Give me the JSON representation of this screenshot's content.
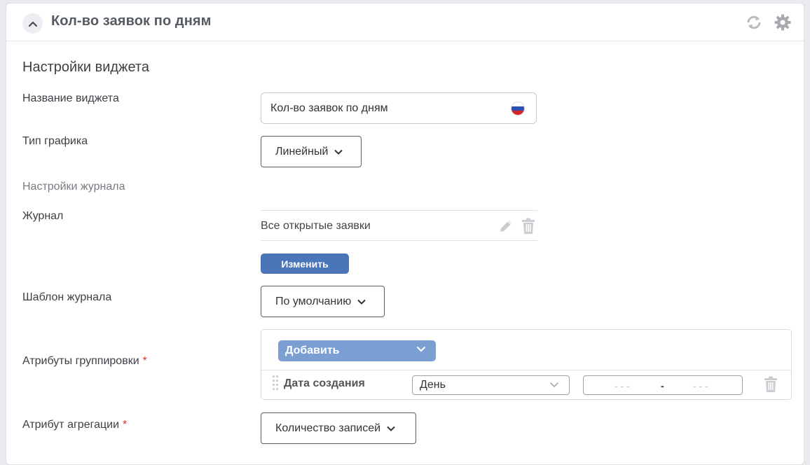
{
  "header": {
    "title": "Кол-во заявок по дням"
  },
  "settings": {
    "section_title": "Настройки виджета",
    "widget_name_label": "Название виджета",
    "widget_name_value": "Кол-во заявок по дням",
    "chart_type_label": "Тип графика",
    "chart_type_value": "Линейный",
    "journal_settings_label": "Настройки журнала",
    "journal_label": "Журнал",
    "journal_value": "Все открытые заявки",
    "change_button": "Изменить",
    "journal_template_label": "Шаблон журнала",
    "journal_template_value": "По умолчанию",
    "grouping_label": "Атрибуты группировки",
    "required_mark": "*",
    "add_button": "Добавить",
    "grouping_row": {
      "attribute": "Дата создания",
      "period": "День",
      "range_from": "- - -",
      "range_sep": "-",
      "range_to": "- - -"
    },
    "aggregation_label": "Атрибут агрегации",
    "aggregation_value": "Количество записей"
  },
  "colors": {
    "accent": "#4a76b9",
    "add_button": "#7b9fd3",
    "required": "#d9342b"
  },
  "icons": [
    "chevron-up-icon",
    "refresh-icon",
    "gear-icon",
    "russian-flag-icon",
    "edit-icon",
    "trash-icon",
    "chevron-down-icon",
    "drag-handle-icon"
  ]
}
